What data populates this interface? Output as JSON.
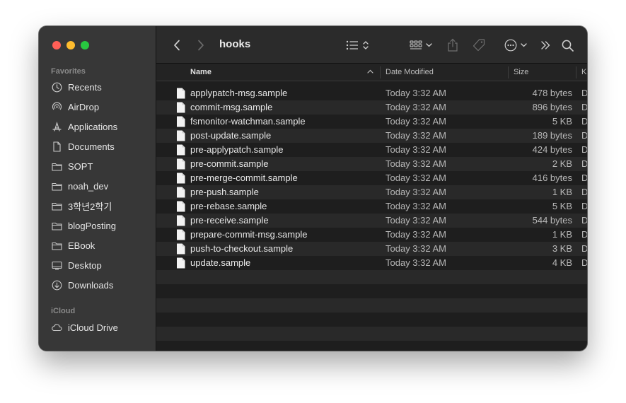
{
  "window": {
    "title": "hooks"
  },
  "sidebar": {
    "favorites_label": "Favorites",
    "icloud_label": "iCloud",
    "favorites": [
      {
        "label": "Recents",
        "icon": "clock-icon"
      },
      {
        "label": "AirDrop",
        "icon": "airdrop-icon"
      },
      {
        "label": "Applications",
        "icon": "applications-icon"
      },
      {
        "label": "Documents",
        "icon": "document-icon"
      },
      {
        "label": "SOPT",
        "icon": "folder-icon"
      },
      {
        "label": "noah_dev",
        "icon": "folder-icon"
      },
      {
        "label": "3학년2학기",
        "icon": "folder-icon"
      },
      {
        "label": "blogPosting",
        "icon": "folder-icon"
      },
      {
        "label": "EBook",
        "icon": "folder-icon"
      },
      {
        "label": "Desktop",
        "icon": "desktop-icon"
      },
      {
        "label": "Downloads",
        "icon": "download-icon"
      }
    ],
    "icloud": [
      {
        "label": "iCloud Drive",
        "icon": "cloud-icon"
      }
    ]
  },
  "columns": {
    "name": "Name",
    "date": "Date Modified",
    "size": "Size",
    "kind": "K"
  },
  "files": [
    {
      "name": "applypatch-msg.sample",
      "date": "Today 3:32 AM",
      "size": "478 bytes",
      "kind": "D"
    },
    {
      "name": "commit-msg.sample",
      "date": "Today 3:32 AM",
      "size": "896 bytes",
      "kind": "D"
    },
    {
      "name": "fsmonitor-watchman.sample",
      "date": "Today 3:32 AM",
      "size": "5 KB",
      "kind": "D"
    },
    {
      "name": "post-update.sample",
      "date": "Today 3:32 AM",
      "size": "189 bytes",
      "kind": "D"
    },
    {
      "name": "pre-applypatch.sample",
      "date": "Today 3:32 AM",
      "size": "424 bytes",
      "kind": "D"
    },
    {
      "name": "pre-commit.sample",
      "date": "Today 3:32 AM",
      "size": "2 KB",
      "kind": "D"
    },
    {
      "name": "pre-merge-commit.sample",
      "date": "Today 3:32 AM",
      "size": "416 bytes",
      "kind": "D"
    },
    {
      "name": "pre-push.sample",
      "date": "Today 3:32 AM",
      "size": "1 KB",
      "kind": "D"
    },
    {
      "name": "pre-rebase.sample",
      "date": "Today 3:32 AM",
      "size": "5 KB",
      "kind": "D"
    },
    {
      "name": "pre-receive.sample",
      "date": "Today 3:32 AM",
      "size": "544 bytes",
      "kind": "D"
    },
    {
      "name": "prepare-commit-msg.sample",
      "date": "Today 3:32 AM",
      "size": "1 KB",
      "kind": "D"
    },
    {
      "name": "push-to-checkout.sample",
      "date": "Today 3:32 AM",
      "size": "3 KB",
      "kind": "D"
    },
    {
      "name": "update.sample",
      "date": "Today 3:32 AM",
      "size": "4 KB",
      "kind": "D"
    }
  ],
  "colors": {
    "close": "#ff5f57",
    "minimize": "#febc2e",
    "maximize": "#28c840",
    "sidebar_bg": "#373737",
    "list_bg": "#1e1e1e",
    "row_alt": "#292929"
  }
}
